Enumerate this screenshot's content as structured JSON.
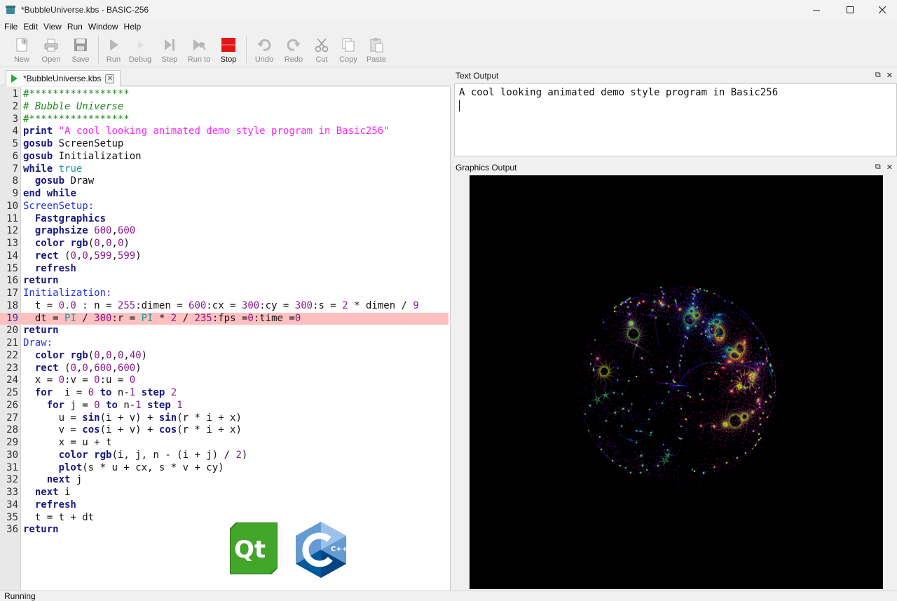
{
  "window": {
    "title": "*BubbleUniverse.kbs - BASIC-256",
    "minimize": "—",
    "maximize": "☐",
    "close": "✕"
  },
  "menu": [
    "File",
    "Edit",
    "View",
    "Run",
    "Window",
    "Help"
  ],
  "toolbar": {
    "new": "New",
    "open": "Open",
    "save": "Save",
    "run": "Run",
    "debug": "Debug",
    "step": "Step",
    "run_to": "Run to",
    "stop": "Stop",
    "undo": "Undo",
    "redo": "Redo",
    "cut": "Cut",
    "copy": "Copy",
    "paste": "Paste"
  },
  "editor": {
    "tab_label": "*BubbleUniverse.kbs",
    "current_line": 19,
    "lines": [
      "#*****************",
      "# Bubble Universe",
      "#*****************",
      "print \"A cool looking animated demo style program in Basic256\"",
      "gosub ScreenSetup",
      "gosub Initialization",
      "while true",
      "  gosub Draw",
      "end while",
      "ScreenSetup:",
      "  Fastgraphics",
      "  graphsize 600,600",
      "  color rgb(0,0,0)",
      "  rect (0,0,599,599)",
      "  refresh",
      "return",
      "Initialization:",
      "  t = 0.0 : n = 255:dimen = 600:cx = 300:cy = 300:s = 2 * dimen / 9",
      "  dt = PI / 300:r = PI * 2 / 235:fps =0:time =0",
      "return",
      "Draw:",
      "  color rgb(0,0,0,40)",
      "  rect (0,0,600,600)",
      "  x = 0:v = 0:u = 0",
      "  for  i = 0 to n-1 step 2",
      "    for j = 0 to n-1 step 1",
      "      u = sin(i + v) + sin(r * i + x)",
      "      v = cos(i + v) + cos(r * i + x)",
      "      x = u + t",
      "      color rgb(i, j, n - (i + j) / 2)",
      "      plot(s * u + cx, s * v + cy)",
      "    next j",
      "  next i",
      "  refresh",
      "  t = t + dt",
      "return"
    ]
  },
  "text_output": {
    "title": "Text Output",
    "content": "A cool looking animated demo style program in Basic256"
  },
  "graphics_output": {
    "title": "Graphics Output"
  },
  "logos": {
    "qt": "Qt",
    "cpp": "C++"
  },
  "dock_buttons": {
    "float": "⧉",
    "close": "✕"
  },
  "status": "Running",
  "colors": {
    "keyword": "#181880",
    "string": "#ff22ff",
    "number": "#8a1a8a",
    "comment": "#1e8a1e",
    "label": "#2233dd",
    "highlight_line": "#ffc0c0",
    "stop_red": "#e01818"
  }
}
